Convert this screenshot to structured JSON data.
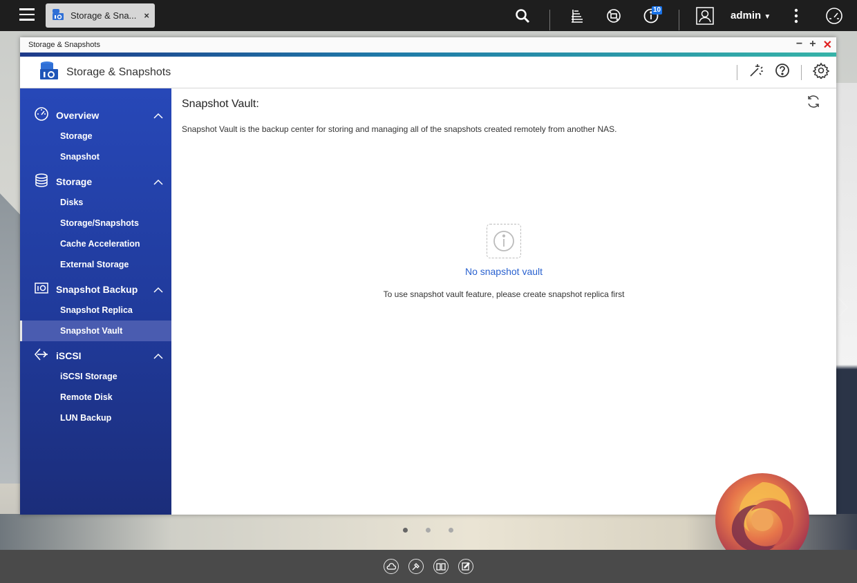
{
  "topbar": {
    "tab_label": "Storage & Sna...",
    "tab_close": "×",
    "notification_count": "10",
    "user_name": "admin"
  },
  "window": {
    "title": "Storage & Snapshots",
    "app_title": "Storage & Snapshots"
  },
  "sidebar": {
    "groups": [
      {
        "label": "Overview",
        "items": [
          "Storage",
          "Snapshot"
        ]
      },
      {
        "label": "Storage",
        "items": [
          "Disks",
          "Storage/Snapshots",
          "Cache Acceleration",
          "External Storage"
        ]
      },
      {
        "label": "Snapshot Backup",
        "items": [
          "Snapshot Replica",
          "Snapshot Vault"
        ]
      },
      {
        "label": "iSCSI",
        "items": [
          "iSCSI Storage",
          "Remote Disk",
          "LUN Backup"
        ]
      }
    ],
    "active_item": "Snapshot Vault"
  },
  "main": {
    "title": "Snapshot Vault:",
    "description": "Snapshot Vault is the backup center for storing and managing all of the snapshots created remotely from another NAS.",
    "empty_title": "No snapshot vault",
    "empty_message": "To use snapshot vault feature, please create snapshot replica first"
  },
  "colors": {
    "sidebar": "#2748b8",
    "accent_link": "#2a62d0",
    "close_red": "#e02020",
    "topbar": "#1e1e1e"
  }
}
